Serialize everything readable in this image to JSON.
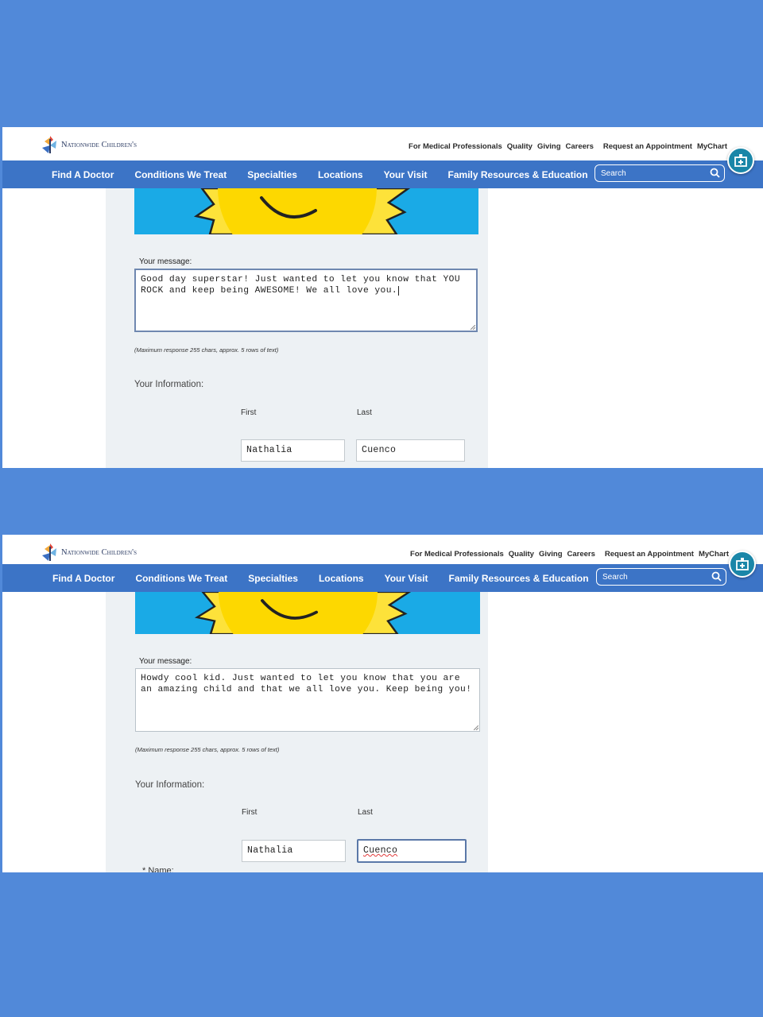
{
  "site": {
    "logo_text": "Nationwide Children's",
    "top_links": [
      "For Medical Professionals",
      "Quality",
      "Giving",
      "Careers"
    ],
    "top_links_right": [
      "Request an Appointment",
      "MyChart"
    ],
    "nav": [
      "Find A Doctor",
      "Conditions We Treat",
      "Specialties",
      "Locations",
      "Your Visit",
      "Family Resources & Education"
    ],
    "search_placeholder": "Search"
  },
  "screens": [
    {
      "message_label": "Your message:",
      "message_text": "Good day superstar! Just wanted to let you know that YOU ROCK and keep being AWESOME! We all love you.",
      "note": "(Maximum response 255 chars, approx. 5 rows of text)",
      "info_label": "Your Information:",
      "first_label": "First",
      "last_label": "Last",
      "first_value": "Nathalia",
      "last_value": "Cuenco"
    },
    {
      "message_label": "Your message:",
      "message_text": "Howdy cool kid. Just wanted to let you know that you are an amazing child and that we all love you. Keep being you!",
      "note": "(Maximum response 255 chars, approx. 5 rows of text)",
      "info_label": "Your Information:",
      "first_label": "First",
      "last_label": "Last",
      "first_value": "Nathalia",
      "last_value": "Cuenco",
      "name_label_partial": "* Name:"
    }
  ],
  "colors": {
    "background": "#5189d9",
    "nav": "#3c74c6",
    "panel": "#edf1f4",
    "banner_sky": "#1aaae6",
    "sun": "#fdd800",
    "chat_button": "#1a86a8"
  }
}
